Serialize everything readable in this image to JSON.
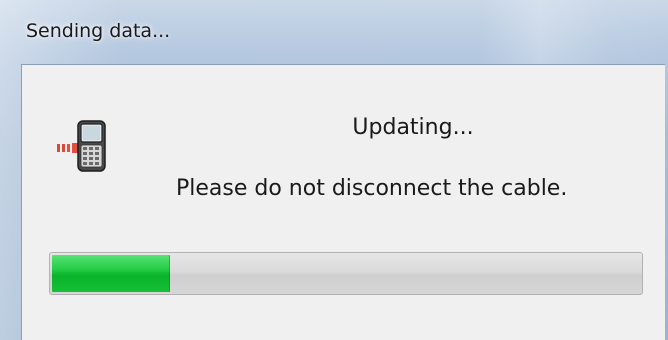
{
  "window": {
    "title": "Sending data..."
  },
  "dialog": {
    "status": "Updating...",
    "message": "Please do not disconnect the cable.",
    "icon": "calculator-transfer-icon"
  },
  "progress": {
    "fraction": 0.2
  },
  "colors": {
    "progress_fill": "#22cc44",
    "progress_track": "#d6d6d6",
    "client_area": "#f0f0f0"
  }
}
